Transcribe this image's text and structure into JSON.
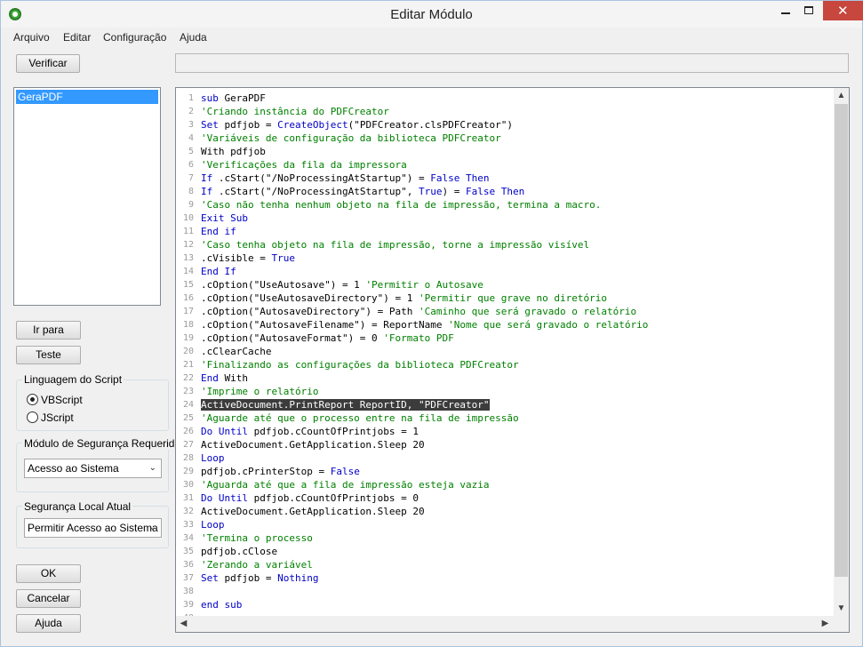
{
  "window": {
    "title": "Editar Módulo"
  },
  "menu": [
    "Arquivo",
    "Editar",
    "Configuração",
    "Ajuda"
  ],
  "buttons": {
    "verificar": "Verificar",
    "ir_para": "Ir para",
    "teste": "Teste",
    "ok": "OK",
    "cancelar": "Cancelar",
    "ajuda": "Ajuda"
  },
  "modules": [
    "GeraPDF"
  ],
  "script_language": {
    "label": "Linguagem do Script",
    "options": [
      "VBScript",
      "JScript"
    ],
    "selected": "VBScript"
  },
  "security_required": {
    "label": "Módulo de Segurança Requerido",
    "value": "Acesso ao Sistema"
  },
  "security_current": {
    "label": "Segurança Local Atual",
    "value": "Permitir Acesso ao Sistema"
  },
  "colors": {
    "keyword": "#0000c8",
    "comment": "#008000",
    "selection": "#3399ff"
  },
  "code_lines": [
    [
      [
        "k",
        "sub"
      ],
      [
        "t",
        " GeraPDF"
      ]
    ],
    [
      [
        "c",
        "'Criando instância do PDFCreator"
      ]
    ],
    [
      [
        "k",
        "Set"
      ],
      [
        "t",
        " pdfjob = "
      ],
      [
        "k",
        "CreateObject"
      ],
      [
        "t",
        "(\"PDFCreator.clsPDFCreator\")"
      ]
    ],
    [
      [
        "c",
        "'Variáveis de configuração da biblioteca PDFCreator"
      ]
    ],
    [
      [
        "t",
        "With pdfjob"
      ]
    ],
    [
      [
        "c",
        "'Verificações da fila da impressora"
      ]
    ],
    [
      [
        "k",
        "If"
      ],
      [
        "t",
        " .cStart(\"/NoProcessingAtStartup\") = "
      ],
      [
        "k",
        "False Then"
      ]
    ],
    [
      [
        "k",
        "If"
      ],
      [
        "t",
        " .cStart(\"/NoProcessingAtStartup\", "
      ],
      [
        "k",
        "True"
      ],
      [
        "t",
        ") = "
      ],
      [
        "k",
        "False Then"
      ]
    ],
    [
      [
        "c",
        "'Caso não tenha nenhum objeto na fila de impressão, termina a macro."
      ]
    ],
    [
      [
        "k",
        "Exit Sub"
      ]
    ],
    [
      [
        "k",
        "End if"
      ]
    ],
    [
      [
        "c",
        "'Caso tenha objeto na fila de impressão, torne a impressão visível"
      ]
    ],
    [
      [
        "t",
        ".cVisible = "
      ],
      [
        "k",
        "True"
      ]
    ],
    [
      [
        "k",
        "End If"
      ]
    ],
    [
      [
        "t",
        ".cOption(\"UseAutosave\") = 1 "
      ],
      [
        "c",
        "'Permitir o Autosave"
      ]
    ],
    [
      [
        "t",
        ".cOption(\"UseAutosaveDirectory\") = 1 "
      ],
      [
        "c",
        "'Permitir que grave no diretório"
      ]
    ],
    [
      [
        "t",
        ".cOption(\"AutosaveDirectory\") = Path "
      ],
      [
        "c",
        "'Caminho que será gravado o relatório"
      ]
    ],
    [
      [
        "t",
        ".cOption(\"AutosaveFilename\") = ReportName "
      ],
      [
        "c",
        "'Nome que será gravado o relatório"
      ]
    ],
    [
      [
        "t",
        ".cOption(\"AutosaveFormat\") = 0 "
      ],
      [
        "c",
        "'Formato PDF"
      ]
    ],
    [
      [
        "t",
        ".cClearCache"
      ]
    ],
    [
      [
        "c",
        "'Finalizando as configurações da biblioteca PDFCreator"
      ]
    ],
    [
      [
        "k",
        "End"
      ],
      [
        "t",
        " With"
      ]
    ],
    [
      [
        "c",
        "'Imprime o relatório"
      ]
    ],
    [
      [
        "h",
        "ActiveDocument.PrintReport ReportID, \"PDFCreator\""
      ]
    ],
    [
      [
        "c",
        "'Aguarde até que o processo entre na fila de impressão"
      ]
    ],
    [
      [
        "k",
        "Do Until"
      ],
      [
        "t",
        " pdfjob.cCountOfPrintjobs = 1"
      ]
    ],
    [
      [
        "t",
        "ActiveDocument.GetApplication.Sleep 20"
      ]
    ],
    [
      [
        "k",
        "Loop"
      ]
    ],
    [
      [
        "t",
        "pdfjob.cPrinterStop = "
      ],
      [
        "k",
        "False"
      ]
    ],
    [
      [
        "c",
        "'Aguarda até que a fila de impressão esteja vazia"
      ]
    ],
    [
      [
        "k",
        "Do Until"
      ],
      [
        "t",
        " pdfjob.cCountOfPrintjobs = 0"
      ]
    ],
    [
      [
        "t",
        "ActiveDocument.GetApplication.Sleep 20"
      ]
    ],
    [
      [
        "k",
        "Loop"
      ]
    ],
    [
      [
        "c",
        "'Termina o processo"
      ]
    ],
    [
      [
        "t",
        "pdfjob.cClose"
      ]
    ],
    [
      [
        "c",
        "'Zerando a variável"
      ]
    ],
    [
      [
        "k",
        "Set"
      ],
      [
        "t",
        " pdfjob = "
      ],
      [
        "k",
        "Nothing"
      ]
    ],
    [],
    [
      [
        "k",
        "end sub"
      ]
    ]
  ],
  "partial_last_line_number": "40"
}
